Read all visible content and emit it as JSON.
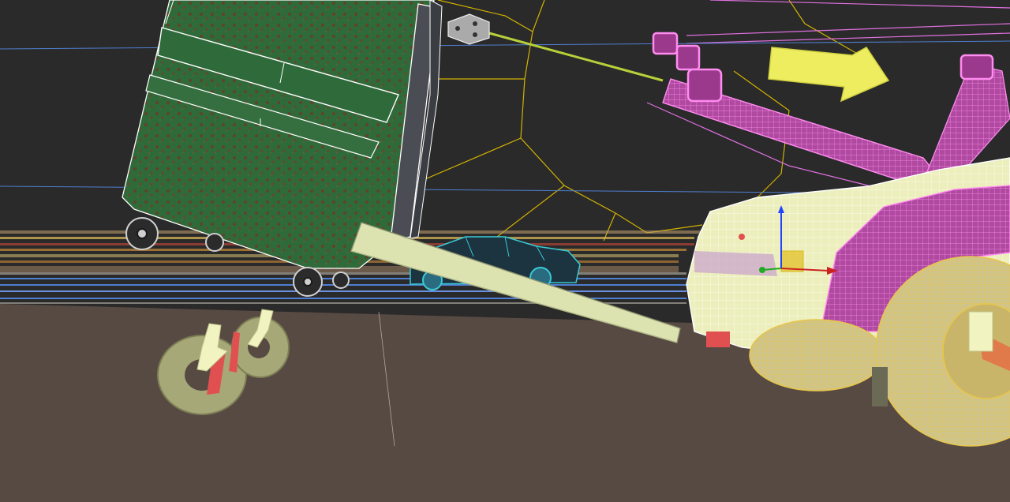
{
  "viewport": {
    "colors": {
      "sky": "#2a2a2a",
      "ground": "#574a43",
      "grid_blue": "#4f7fd0",
      "gizmo_yellow": "#d2b200",
      "wire_pink": "#e070e0",
      "wire_white": "#ffffff",
      "dumpster_green": "#2f6a3a",
      "rust": "#7a3b24",
      "tow_body": "#ecefbc",
      "tire": "#ccc79a",
      "arrow": "#eded5f",
      "light_line": "#b8d03a",
      "car_dark": "#1c3340",
      "car_wire": "#3ac9d6",
      "red_accent": "#e05050"
    },
    "objects": [
      {
        "id": "dumpster",
        "icon": "dumpster-icon"
      },
      {
        "id": "ramp",
        "icon": "ramp-icon"
      },
      {
        "id": "tow-truck",
        "icon": "tow-truck-icon"
      },
      {
        "id": "sedan",
        "icon": "car-icon"
      },
      {
        "id": "tire-wheel-left",
        "icon": "tire-icon"
      },
      {
        "id": "tire-wheel-right",
        "icon": "tire-icon"
      },
      {
        "id": "spotlight",
        "icon": "spotlight-icon"
      },
      {
        "id": "direction-arrow",
        "icon": "arrow-right-icon"
      },
      {
        "id": "transform-gizmo",
        "icon": "gizmo-icon"
      }
    ]
  }
}
